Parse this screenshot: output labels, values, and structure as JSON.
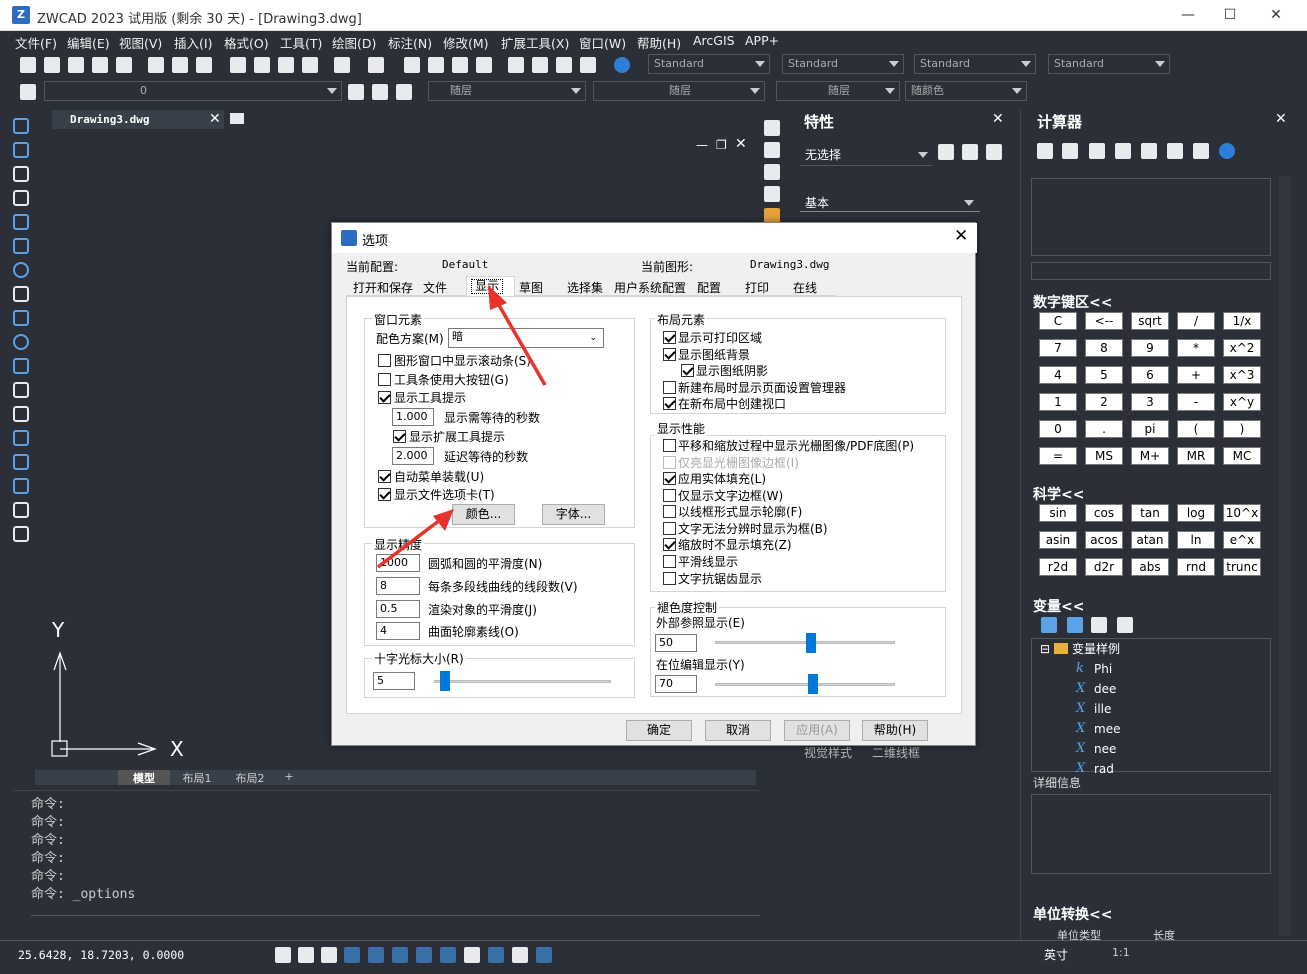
{
  "app": {
    "title": "ZWCAD 2023 试用版 (剩余 30 天) - [Drawing3.dwg]",
    "icon": "zwcad-logo-icon"
  },
  "menu": [
    "文件(F)",
    "编辑(E)",
    "视图(V)",
    "插入(I)",
    "格式(O)",
    "工具(T)",
    "绘图(D)",
    "标注(N)",
    "修改(M)",
    "扩展工具(X)",
    "窗口(W)",
    "帮助(H)",
    "ArcGIS",
    "APP+"
  ],
  "toolbar": {
    "style1": "Standard",
    "style2": "Standard",
    "style3": "Standard",
    "style4": "Standard",
    "layer": "0",
    "color": "随层",
    "linetype": "随层",
    "lineweight": "随层",
    "plotstyle": "随颜色"
  },
  "doc": {
    "tab": "Drawing3.dwg",
    "axis_y": "Y",
    "axis_x": "X"
  },
  "layouts": [
    "模型",
    "布局1",
    "布局2",
    "+"
  ],
  "cmd": {
    "lines": [
      "命令:",
      "命令:",
      "命令:",
      "命令:",
      "命令:",
      "命令: _options"
    ]
  },
  "status": {
    "coords": "25.6428, 18.7203, 0.0000",
    "unit": "英寸",
    "scale": "1:1"
  },
  "props": {
    "title": "特性",
    "selection": "无选择",
    "group": "基本",
    "visual_label": "视觉样式",
    "visual_value": "二维线框"
  },
  "calc": {
    "title": "计算器",
    "numpad_title": "数字键区<<",
    "science_title": "科学<<",
    "vars_title": "变量<<",
    "detail_title": "详细信息",
    "unit_title": "单位转换<<",
    "unit_type": "单位类型",
    "unit_len": "长度",
    "numpad": [
      [
        "C",
        "<--",
        "sqrt",
        "/",
        "1/x"
      ],
      [
        "7",
        "8",
        "9",
        "*",
        "x^2"
      ],
      [
        "4",
        "5",
        "6",
        "+",
        "x^3"
      ],
      [
        "1",
        "2",
        "3",
        "-",
        "x^y"
      ],
      [
        "0",
        ".",
        "pi",
        "(",
        ")"
      ],
      [
        "=",
        "MS",
        "M+",
        "MR",
        "MC"
      ]
    ],
    "science": [
      [
        "sin",
        "cos",
        "tan",
        "log",
        "10^x"
      ],
      [
        "asin",
        "acos",
        "atan",
        "ln",
        "e^x"
      ],
      [
        "r2d",
        "d2r",
        "abs",
        "rnd",
        "trunc"
      ]
    ],
    "var_root": "变量样例",
    "vars": [
      {
        "k": "k",
        "n": "Phi"
      },
      {
        "k": "X",
        "n": "dee"
      },
      {
        "k": "X",
        "n": "ille"
      },
      {
        "k": "X",
        "n": "mee"
      },
      {
        "k": "X",
        "n": "nee"
      },
      {
        "k": "X",
        "n": "rad"
      }
    ]
  },
  "dialog": {
    "title": "选项",
    "cfg_label": "当前配置:",
    "cfg_value": "Default",
    "drw_label": "当前图形:",
    "drw_value": "Drawing3.dwg",
    "tabs": [
      "打开和保存",
      "文件",
      "显示",
      "草图",
      "选择集",
      "用户系统配置",
      "配置",
      "打印",
      "在线"
    ],
    "win": {
      "title": "窗口元素",
      "scheme_label": "配色方案(M)",
      "scheme_value": "暗",
      "scroll": "图形窗口中显示滚动条(S)",
      "bigbtn": "工具条使用大按钮(G)",
      "tips": "显示工具提示",
      "tipsec_val": "1.000",
      "tipsec": "显示需等待的秒数",
      "exttips": "显示扩展工具提示",
      "delay_val": "2.000",
      "delay": "延迟等待的秒数",
      "automenu": "自动菜单装载(U)",
      "filetabs": "显示文件选项卡(T)",
      "color_btn": "颜色...",
      "font_btn": "字体..."
    },
    "prec": {
      "title": "显示精度",
      "arc_val": "1000",
      "arc": "圆弧和圆的平滑度(N)",
      "seg_val": "8",
      "seg": "每条多段线曲线的线段数(V)",
      "render_val": "0.5",
      "render": "渲染对象的平滑度(J)",
      "surf_val": "4",
      "surf": "曲面轮廓素线(O)"
    },
    "cross": {
      "title": "十字光标大小(R)",
      "val": "5"
    },
    "layout": {
      "title": "布局元素",
      "printable": "显示可打印区域",
      "paperbg": "显示图纸背景",
      "shadow": "显示图纸阴影",
      "newlayout": "新建布局时显示页面设置管理器",
      "viewport": "在新布局中创建视口"
    },
    "perf": {
      "title": "显示性能",
      "pan": "平移和缩放过程中显示光栅图像/PDF底图(P)",
      "raster": "仅亮显光栅图像边框(I)",
      "fill": "应用实体填充(L)",
      "textbox": "仅显示文字边框(W)",
      "wire": "以线框形式显示轮廓(F)",
      "textframe": "文字无法分辨时显示为框(B)",
      "nofill": "缩放时不显示填充(Z)",
      "smooth": "平滑线显示",
      "aa": "文字抗锯齿显示"
    },
    "fade": {
      "title": "褪色度控制",
      "xref": "外部参照显示(E)",
      "xref_val": "50",
      "xref_level": 0.5,
      "edit": "在位编辑显示(Y)",
      "edit_val": "70",
      "edit_level": 0.7
    },
    "ok": "确定",
    "cancel": "取消",
    "apply": "应用(A)",
    "help": "帮助(H)"
  },
  "colors": {
    "accent": "#0078d7",
    "arrow": "#e8322b",
    "dark": "#2b3038"
  }
}
